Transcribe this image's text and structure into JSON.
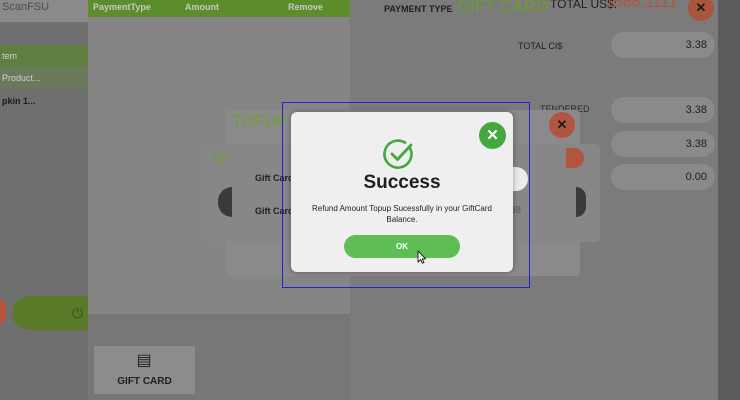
{
  "left_panel": {
    "search_text": "ScanFSU",
    "rows": [
      "tem",
      "Product...",
      "pkin 1..."
    ]
  },
  "payment": {
    "table_headers": [
      "PaymentType",
      "Amount",
      "Remove"
    ],
    "payment_type_label": "PAYMENT TYPE",
    "payment_type_value": "GIFT CARD",
    "total_us_label": "TOTAL US$:",
    "total_us_value": "1566.1111",
    "total_ci_label": "TOTAL CI$",
    "fields": [
      "3.38",
      "3.38",
      "3.38",
      "0.00"
    ],
    "side_label_partial": "TENDERED",
    "tile_label": "GIFT CARD",
    "close_symbol": "✕"
  },
  "topup_dialog": {
    "title": "TOPUP G",
    "close_symbol": "✕"
  },
  "giftcard_dialog": {
    "title": "Gi",
    "label1": "Gift Card",
    "label2": "Gift Card",
    "value_partial": "38"
  },
  "success_dialog": {
    "title": "Success",
    "message": "Refund Amount Topup Sucessfully in your GiftCard Balance.",
    "ok_label": "OK",
    "close_symbol": "✕",
    "accent_color": "#43a93e"
  },
  "colors": {
    "green_accent": "#6f9e30",
    "orange_accent": "#b0563f",
    "focus_outline": "#2121d6"
  }
}
